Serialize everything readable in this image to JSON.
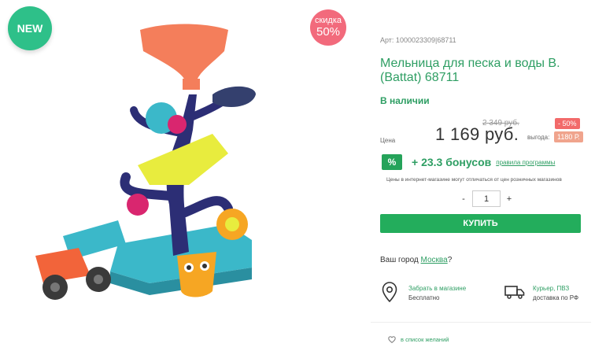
{
  "badges": {
    "new": "NEW",
    "sale_line1": "скидка",
    "sale_line2": "50%"
  },
  "product": {
    "sku": "Арт: 1000023309|68711",
    "title": "Мельница для песка и воды B. (Battat) 68711",
    "stock": "В наличии"
  },
  "price": {
    "label": "Цена",
    "old": "2 349 руб.",
    "current": "1 169 руб.",
    "discount": "- 50%",
    "savings_label": "выгода:",
    "savings": "1180 Р."
  },
  "bonus": {
    "icon": "%",
    "text": "+ 23.3 бонусов",
    "link": "правила программы"
  },
  "note": "Цены в интернет-магазине могут отличаться от цен розничных магазинов",
  "quantity": {
    "minus": "-",
    "value": "1",
    "plus": "+"
  },
  "buy_label": "КУПИТЬ",
  "city": {
    "prefix": "Ваш город ",
    "name": "Москва",
    "suffix": "?"
  },
  "delivery": {
    "pickup_title": "Забрать в магазине",
    "pickup_sub": "Бесплатно",
    "courier_title": "Курьер, ПВЗ",
    "courier_sub": "доставка по РФ"
  },
  "wishlist_label": "в список желаний",
  "colors": {
    "accent_green": "#23ad5c",
    "new_badge": "#2ec089",
    "sale_badge": "#f26a7c"
  },
  "icons": [
    "percent-icon",
    "location-pin-icon",
    "truck-icon",
    "heart-icon"
  ]
}
